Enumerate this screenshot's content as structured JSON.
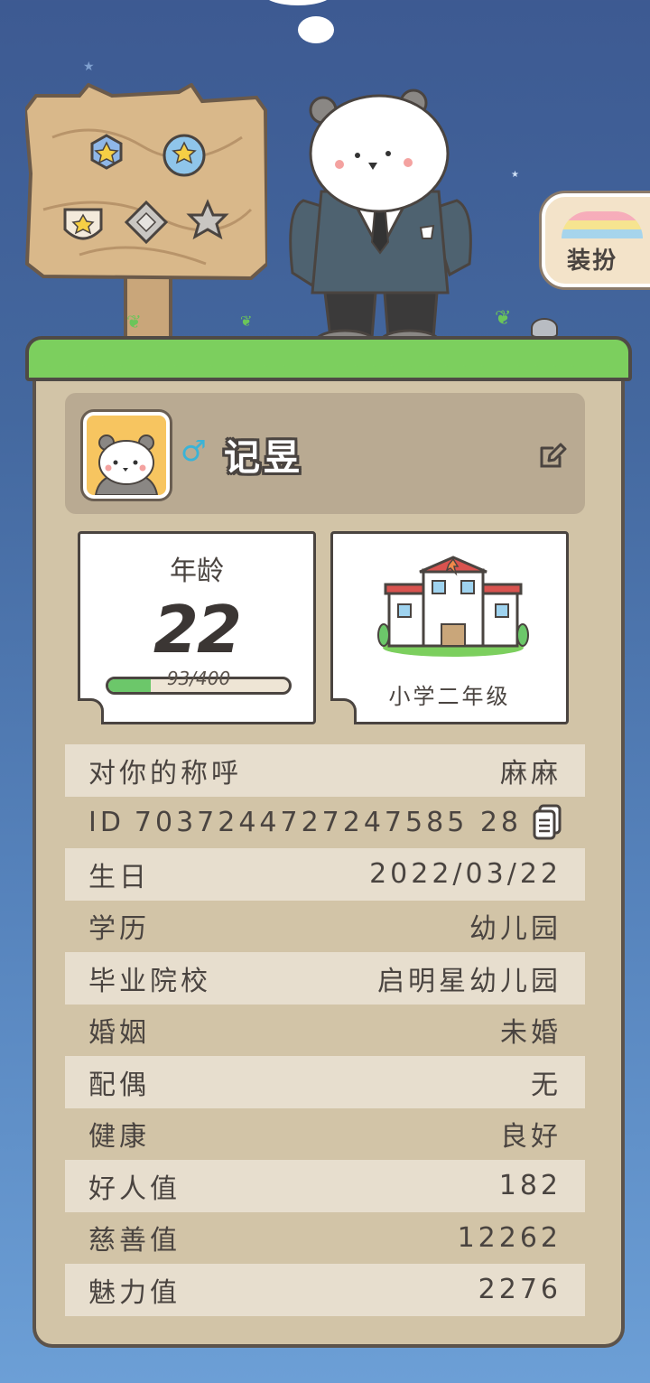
{
  "dress_up": {
    "label": "装扮"
  },
  "profile": {
    "gender_symbol": "♂",
    "name": "记昱"
  },
  "age_card": {
    "label": "年龄",
    "value": "22",
    "progress_text": "93/400",
    "progress": 0.2325
  },
  "school_card": {
    "label": "小学二年级"
  },
  "info_rows": [
    {
      "key": "对你的称呼",
      "value": "麻麻"
    },
    {
      "key": "ID",
      "value": "7037244727247585 28"
    },
    {
      "key": "生日",
      "value": "2022/03/22"
    },
    {
      "key": "学历",
      "value": "幼儿园"
    },
    {
      "key": "毕业院校",
      "value": "启明星幼儿园"
    },
    {
      "key": "婚姻",
      "value": "未婚"
    },
    {
      "key": "配偶",
      "value": "无"
    },
    {
      "key": "健康",
      "value": "良好"
    },
    {
      "key": "好人值",
      "value": "182"
    },
    {
      "key": "慈善值",
      "value": "12262"
    },
    {
      "key": "魅力值",
      "value": "2276"
    }
  ],
  "colors": {
    "grass": "#7ccf5e",
    "panel": "#d2c4a7",
    "accent_blue": "#3bb3d6",
    "progress": "#6cc76a"
  }
}
